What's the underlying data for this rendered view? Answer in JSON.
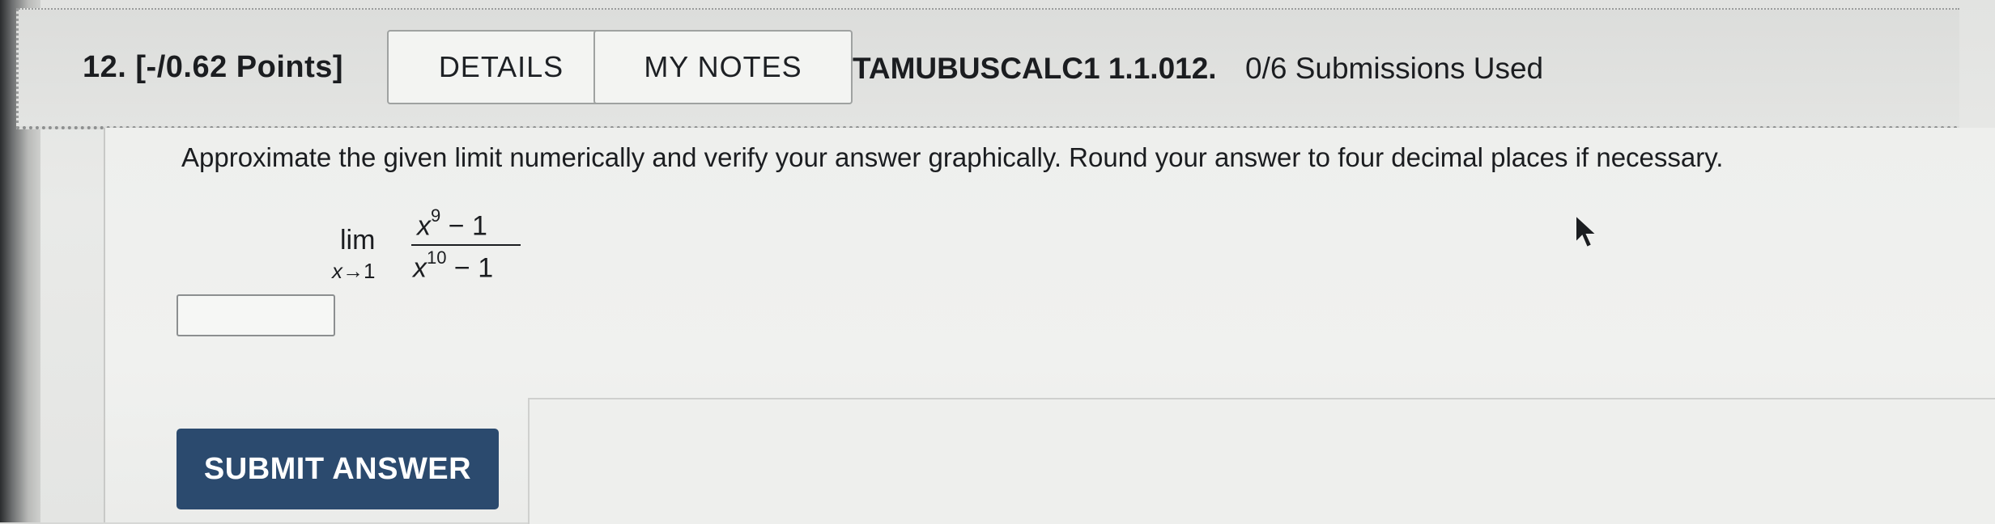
{
  "question": {
    "number_points": "12.  [-/0.62 Points]",
    "details_label": "DETAILS",
    "notes_label": "MY NOTES",
    "problem_code": "TAMUBUSCALC1 1.1.012.",
    "submissions": "0/6 Submissions Used"
  },
  "body": {
    "prompt": "Approximate the given limit numerically and verify your answer graphically. Round your answer to four decimal places if necessary.",
    "limit": {
      "lim": "lim",
      "approach_var": "x",
      "arrow": "→",
      "approach_value": "1",
      "num_base": "x",
      "num_exp": "9",
      "num_tail": " − 1",
      "den_base": "x",
      "den_exp": "10",
      "den_tail": " − 1"
    },
    "answer_value": "",
    "submit_label": "SUBMIT ANSWER"
  },
  "colors": {
    "submit_bg": "#2b4a6e",
    "page_bg": "#e9eae8"
  },
  "icons": {
    "cursor": "mouse-pointer-icon"
  }
}
